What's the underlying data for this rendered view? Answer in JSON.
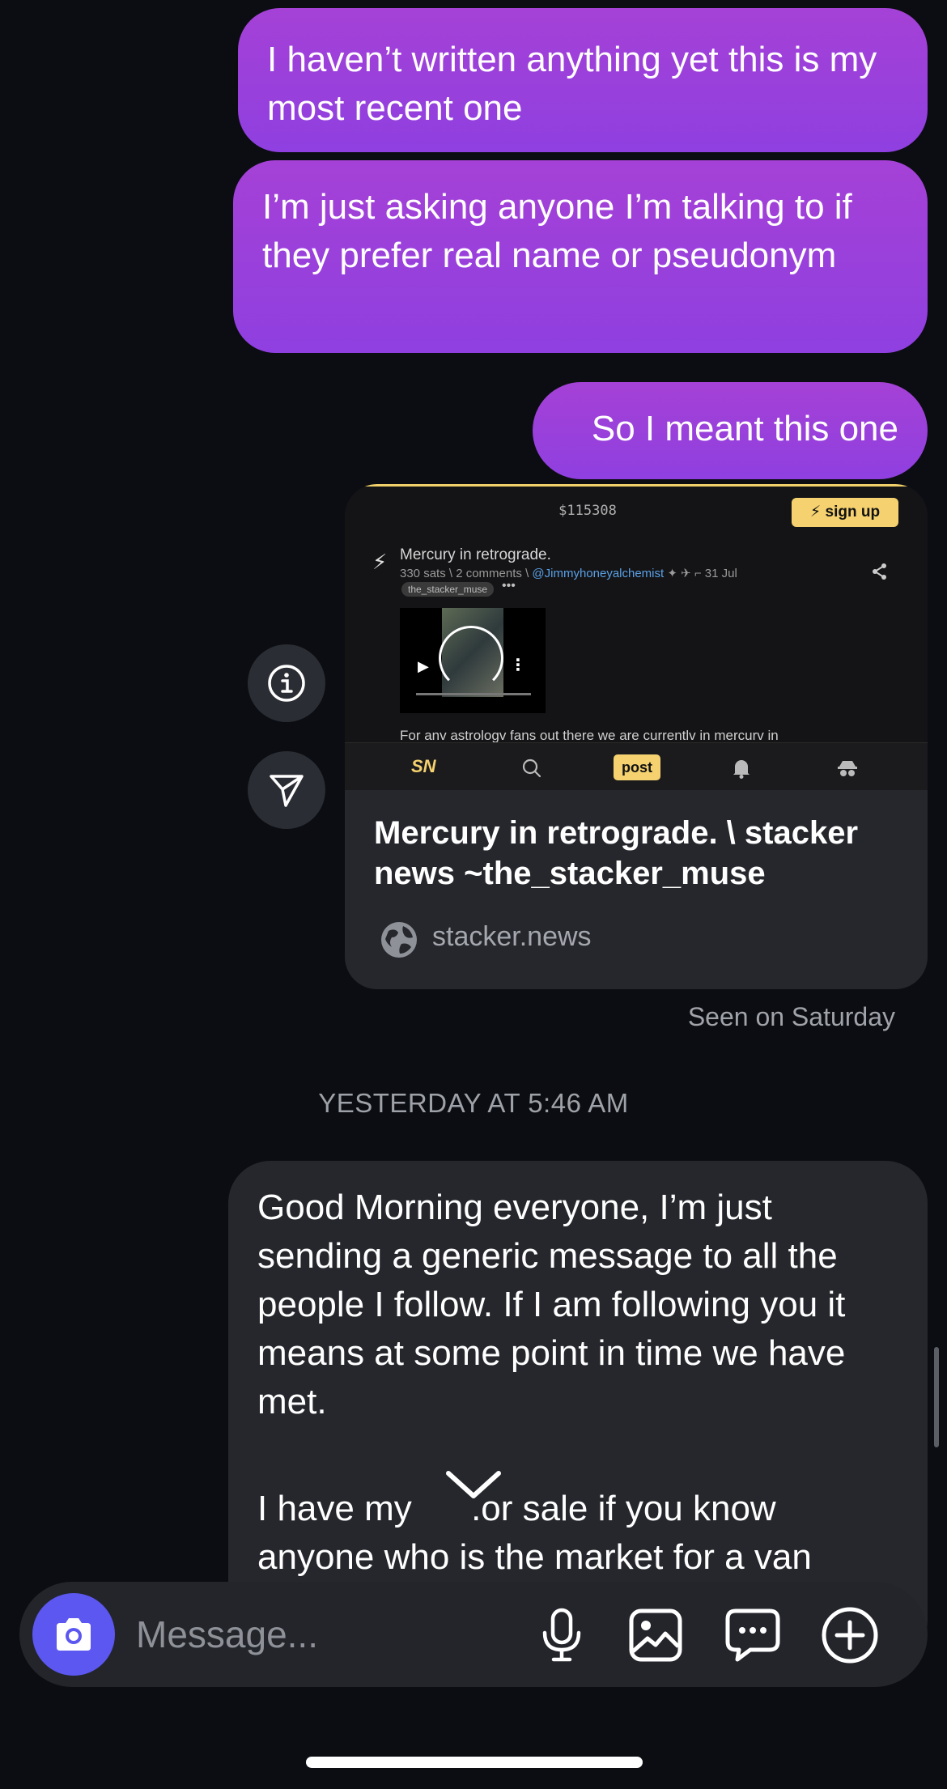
{
  "messages": {
    "m1": "I haven’t written anything yet this is my most recent one",
    "m2": "I’m just asking anyone I’m talking to if they prefer real name or pseudonym",
    "m3": "So I meant this one"
  },
  "link_preview": {
    "screenshot": {
      "price": "$115308",
      "signup_label": "sign up",
      "post_title": "Mercury in retrograde.",
      "post_meta_prefix": "330 sats \\ 2 comments \\ ",
      "post_user": "@Jimmyhoneyalchemist",
      "post_date": "31 Jul",
      "tag": "the_stacker_muse",
      "more": "•••",
      "body_text": "For anv astrologv fans out there we are currentlv in mercurv in",
      "nav_logo": "SN",
      "nav_post": "post"
    },
    "title": "Mercury in retrograde. \\ stacker news ~the_stacker_muse",
    "domain": "stacker.news"
  },
  "seen_status": "Seen on Saturday",
  "timestamp": "YESTERDAY AT 5:46 AM",
  "incoming": {
    "para1": "Good Morning everyone, I’m just sending a generic message to all the people I follow. If I am following you it means at some point in time we have met.",
    "para2": "I have my      .or sale if you know anyone who is the market for a van"
  },
  "composer": {
    "placeholder": "Message..."
  },
  "icons": [
    "info-icon",
    "send-icon",
    "camera-icon",
    "mic-icon",
    "gallery-icon",
    "sticker-icon",
    "plus-icon",
    "globe-icon",
    "chevron-down-icon"
  ],
  "colors": {
    "background": "#0b0d12",
    "outgoing_bubble": "#9b40dc",
    "incoming_bubble": "#25272d",
    "camera_button": "#5b57f0",
    "accent_yellow": "#f5d26f"
  }
}
